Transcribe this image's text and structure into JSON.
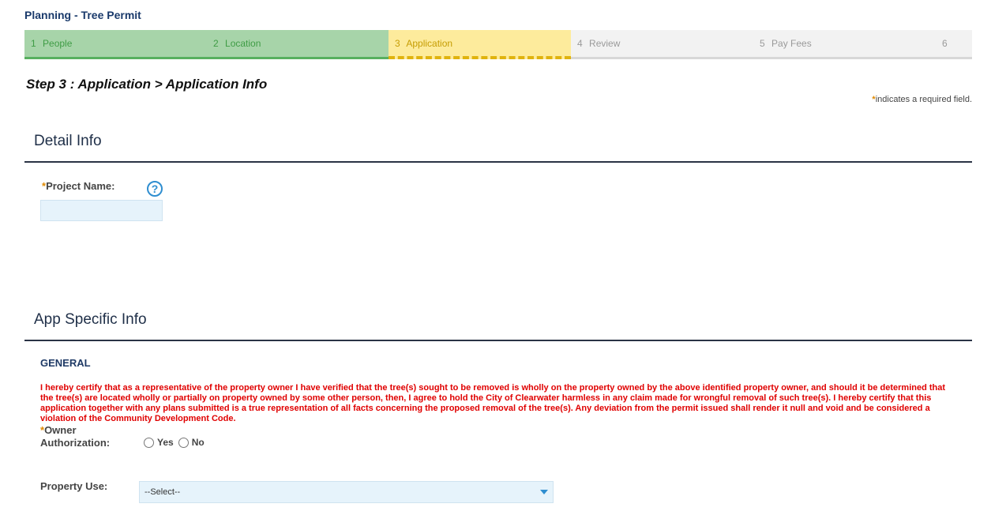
{
  "page": {
    "title": "Planning - Tree Permit"
  },
  "steps": [
    {
      "num": "1",
      "label": "People",
      "state": "done"
    },
    {
      "num": "2",
      "label": "Location",
      "state": "done"
    },
    {
      "num": "3",
      "label": "Application",
      "state": "current"
    },
    {
      "num": "4",
      "label": "Review",
      "state": "todo"
    },
    {
      "num": "5",
      "label": "Pay Fees",
      "state": "todo"
    },
    {
      "num": "6",
      "label": "",
      "state": "todo"
    }
  ],
  "step_heading": "Step 3 : Application > Application Info",
  "required_note": {
    "star": "*",
    "text": "indicates a required field."
  },
  "detail_info": {
    "title": "Detail Info",
    "project_name": {
      "star": "*",
      "label": "Project Name:",
      "value": "",
      "help_icon": "question-icon"
    }
  },
  "app_specific": {
    "title": "App Specific Info",
    "group": "GENERAL",
    "certification": "I hereby certify that as a representative of the property owner I have verified that the tree(s) sought to be removed is wholly on the property owned by the above identified property owner, and should it be determined that the tree(s) are located wholly or partially on property owned by some other person, then, I agree to hold the City of Clearwater harmless in any claim made for wrongful removal of such tree(s). I hereby certify that this application together with any plans submitted is a true representation of all facts concerning the proposed removal of the tree(s). Any deviation from the permit issued shall render it null and void and be considered a violation of the Community Development Code.",
    "owner_auth": {
      "star": "*",
      "label_line1": "Owner",
      "label_line2": "Authorization:",
      "yes": "Yes",
      "no": "No"
    },
    "property_use": {
      "label": "Property Use:",
      "selected": "--Select--"
    }
  },
  "colors": {
    "done_bg": "#a7d4a9",
    "current_bg": "#fdeb9c",
    "todo_bg": "#f2f2f2",
    "required_star": "#e08a00",
    "certification_text": "#e00000"
  }
}
